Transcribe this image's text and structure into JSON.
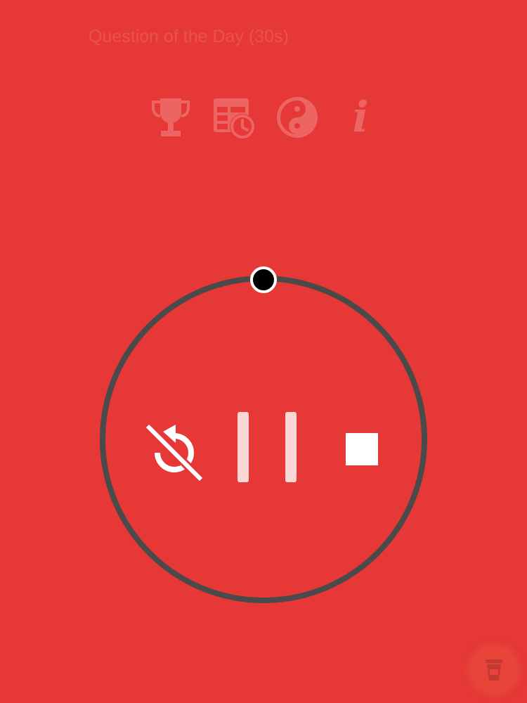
{
  "header": {
    "title": "Question of the Day (30s)"
  },
  "toolbar": {
    "icons": [
      "trophy-icon",
      "schedule-table-icon",
      "yin-yang-icon",
      "info-icon"
    ],
    "info_glyph": "i"
  },
  "timer": {
    "progress": 0,
    "controls": [
      "reset-off-icon",
      "pause-icon",
      "stop-icon"
    ]
  },
  "fab": {
    "icon": "cup-icon"
  },
  "colors": {
    "background": "#e63837",
    "ring": "#4a4a4a",
    "knob": "#000000",
    "knob_border": "#ffffff",
    "faded_icon": "#ec6563",
    "control": "#ffffff",
    "pause_bar": "#fbd6d6"
  }
}
